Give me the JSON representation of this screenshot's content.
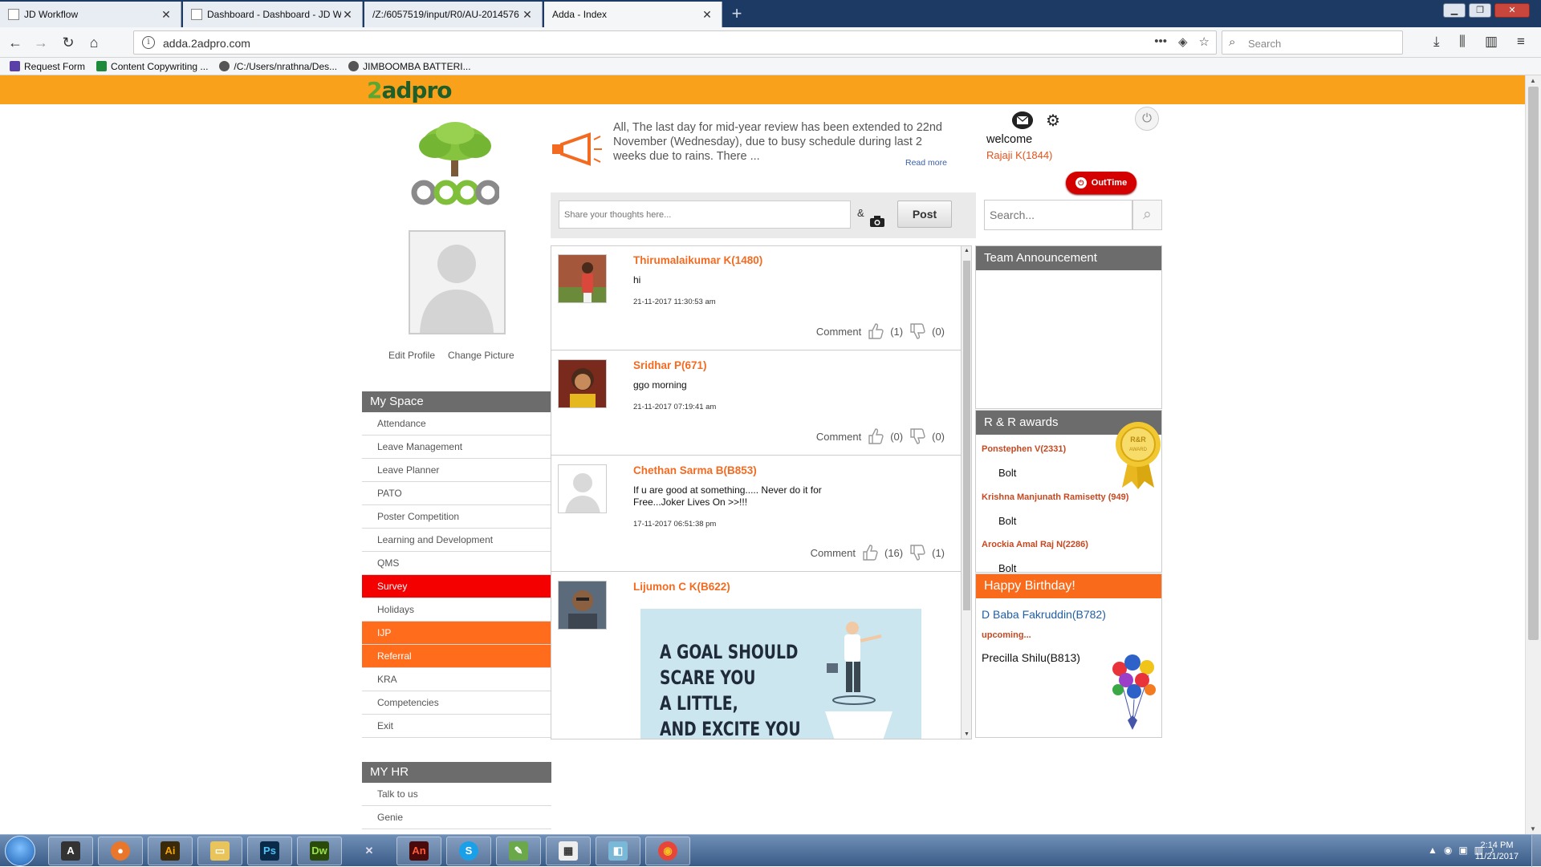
{
  "browser": {
    "tabs": [
      {
        "label": "JD Workflow",
        "active": false
      },
      {
        "label": "Dashboard - Dashboard - JD W",
        "active": false
      },
      {
        "label": "/Z:/6057519/input/R0/AU-2014576",
        "active": false
      },
      {
        "label": "Adda - Index",
        "active": true
      }
    ],
    "url": "adda.2adpro.com",
    "search_placeholder": "Search",
    "bookmarks": [
      {
        "label": "Request Form",
        "color": "#5a3fa8"
      },
      {
        "label": "Content Copywriting ...",
        "color": "#1e8a3c"
      },
      {
        "label": "/C:/Users/nrathna/Des...",
        "color": "#555555"
      },
      {
        "label": "JIMBOOMBA BATTERI...",
        "color": "#555555"
      }
    ]
  },
  "header": {
    "logo_prefix": "2",
    "logo_suffix": "adpro",
    "bar_color": "#f9a11b"
  },
  "sidebar": {
    "edit_profile": "Edit Profile",
    "change_picture": "Change Picture",
    "my_space_title": "My Space",
    "my_space_items": [
      {
        "label": "Attendance",
        "style": ""
      },
      {
        "label": "Leave Management",
        "style": ""
      },
      {
        "label": "Leave Planner",
        "style": ""
      },
      {
        "label": "PATO",
        "style": ""
      },
      {
        "label": "Poster Competition",
        "style": ""
      },
      {
        "label": "Learning and Development",
        "style": ""
      },
      {
        "label": "QMS",
        "style": ""
      },
      {
        "label": "Survey",
        "style": "red"
      },
      {
        "label": "Holidays",
        "style": ""
      },
      {
        "label": "IJP",
        "style": "orange"
      },
      {
        "label": "Referral",
        "style": "orange"
      },
      {
        "label": "KRA",
        "style": ""
      },
      {
        "label": "Competencies",
        "style": ""
      },
      {
        "label": "Exit",
        "style": ""
      }
    ],
    "my_hr_title": "MY HR",
    "my_hr_items": [
      {
        "label": "Talk to us"
      },
      {
        "label": "Genie"
      }
    ]
  },
  "notice": {
    "text": "All, The last day for mid-year review has been extended to 22nd November (Wednesday), due to busy schedule during last 2 weeks due to rains. There ...",
    "read_more": "Read more"
  },
  "composer": {
    "placeholder": "Share your thoughts here...",
    "amp": "&",
    "post_label": "Post"
  },
  "feed": [
    {
      "name": "Thirumalaikumar K(1480)",
      "message": "hi",
      "time": "21-11-2017 11:30:53 am",
      "comment_label": "Comment",
      "likes": "(1)",
      "dislikes": "(0)",
      "avatar_color": "#a5573b"
    },
    {
      "name": "Sridhar P(671)",
      "message": "ggo morning",
      "time": "21-11-2017 07:19:41 am",
      "comment_label": "Comment",
      "likes": "(0)",
      "dislikes": "(0)",
      "avatar_color": "#7a2a1c"
    },
    {
      "name": "Chethan Sarma B(B853)",
      "message": "If u are good at something..... Never do it for Free...Joker Lives On >>!!!",
      "time": "17-11-2017 06:51:38 pm",
      "comment_label": "Comment",
      "likes": "(16)",
      "dislikes": "(1)",
      "avatar_color": "#d9d9d9"
    },
    {
      "name": "Lijumon C K(B622)",
      "message": "",
      "time": "",
      "comment_label": "",
      "likes": "",
      "dislikes": "",
      "avatar_color": "#5b6b7b"
    }
  ],
  "goal_image_lines": [
    "A GOAL SHOULD",
    "SCARE YOU",
    "A LITTLE,",
    "AND EXCITE YOU"
  ],
  "user": {
    "welcome": "welcome",
    "name": "Rajaji K(1844)",
    "out_time_label": "OutTime"
  },
  "right_search_placeholder": "Search...",
  "team_announcement": {
    "title": "Team Announcement"
  },
  "rr_awards": {
    "title": "R & R awards",
    "entries": [
      {
        "name": "Ponstephen V(2331)",
        "award": "Bolt"
      },
      {
        "name": "Krishna Manjunath Ramisetty (949)",
        "award": "Bolt"
      },
      {
        "name": "Arockia Amal Raj N(2286)",
        "award": "Bolt"
      }
    ]
  },
  "birthday": {
    "title": "Happy Birthday!",
    "today": "D Baba Fakruddin(B782)",
    "upcoming_label": "upcoming...",
    "upcoming": "Precilla Shilu(B813)"
  },
  "taskbar": {
    "time": "2:14 PM",
    "date": "11/21/2017"
  }
}
